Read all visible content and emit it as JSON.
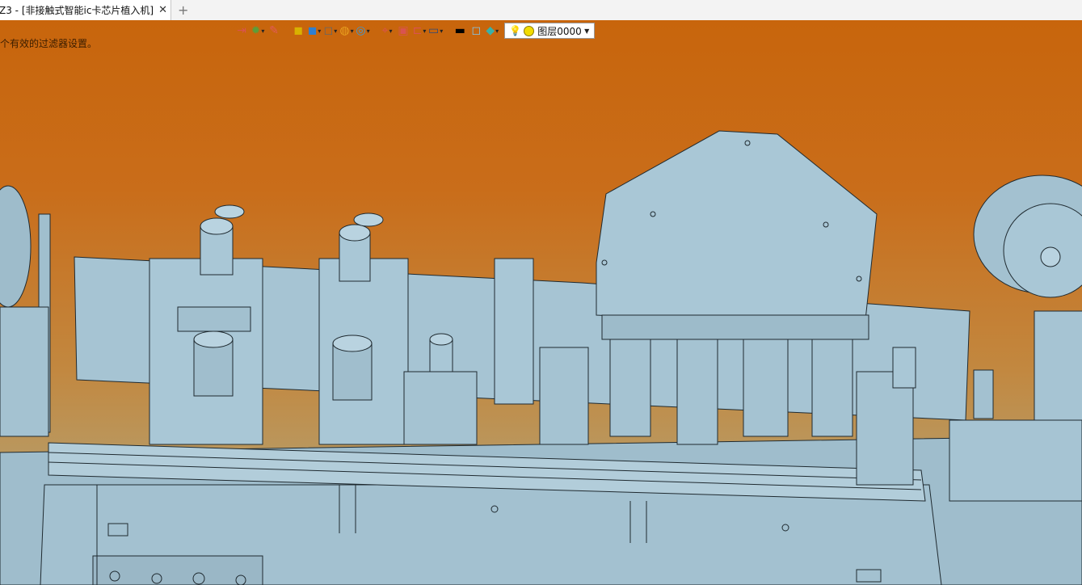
{
  "tab": {
    "title": "Z3 - [非接触式智能ic卡芯片植入机]",
    "close": "✕",
    "add": "+"
  },
  "viewport": {
    "filter_message": "个有效的过滤器设置。"
  },
  "toolbar": {
    "items": [
      {
        "name": "exit-icon",
        "glyph": "⇥",
        "color": "#d9534f",
        "caret": false
      },
      {
        "name": "light-icon",
        "glyph": "✹",
        "color": "#5a9e3a",
        "caret": true
      },
      {
        "name": "pen-icon",
        "glyph": "✎",
        "color": "#e05a5a",
        "caret": false
      },
      {
        "name": "layer-stack-icon",
        "glyph": "◼",
        "color": "#d9b100",
        "caret": false
      },
      {
        "name": "solid-cube-icon",
        "glyph": "◼",
        "color": "#2f7fd0",
        "caret": true
      },
      {
        "name": "wire-cube-icon",
        "glyph": "◻",
        "color": "#666666",
        "caret": true
      },
      {
        "name": "render-icon",
        "glyph": "◍",
        "color": "#e8a020",
        "caret": true
      },
      {
        "name": "zoom-icon",
        "glyph": "◎",
        "color": "#3a9ad9",
        "caret": true
      },
      {
        "name": "axis-icon",
        "glyph": "⌖",
        "color": "#d9534f",
        "caret": true
      },
      {
        "name": "frame-icon",
        "glyph": "▣",
        "color": "#d9534f",
        "caret": false
      },
      {
        "name": "bracket-icon",
        "glyph": "⊏",
        "color": "#d9534f",
        "caret": true
      },
      {
        "name": "monitor-icon",
        "glyph": "▭",
        "color": "#2e4a7a",
        "caret": true
      },
      {
        "name": "line-color-icon",
        "glyph": "▬",
        "color": "#000000",
        "caret": false
      },
      {
        "name": "face-color-icon",
        "glyph": "◻",
        "color": "#7fc7ee",
        "caret": false
      },
      {
        "name": "layer-color-icon",
        "glyph": "◆",
        "color": "#3ab0a8",
        "caret": true
      }
    ],
    "layer_value": "图层0000"
  },
  "colors": {
    "metal": "#a8c6d5",
    "metal_dark": "#8fb0c0",
    "outline": "#1f2a30"
  }
}
